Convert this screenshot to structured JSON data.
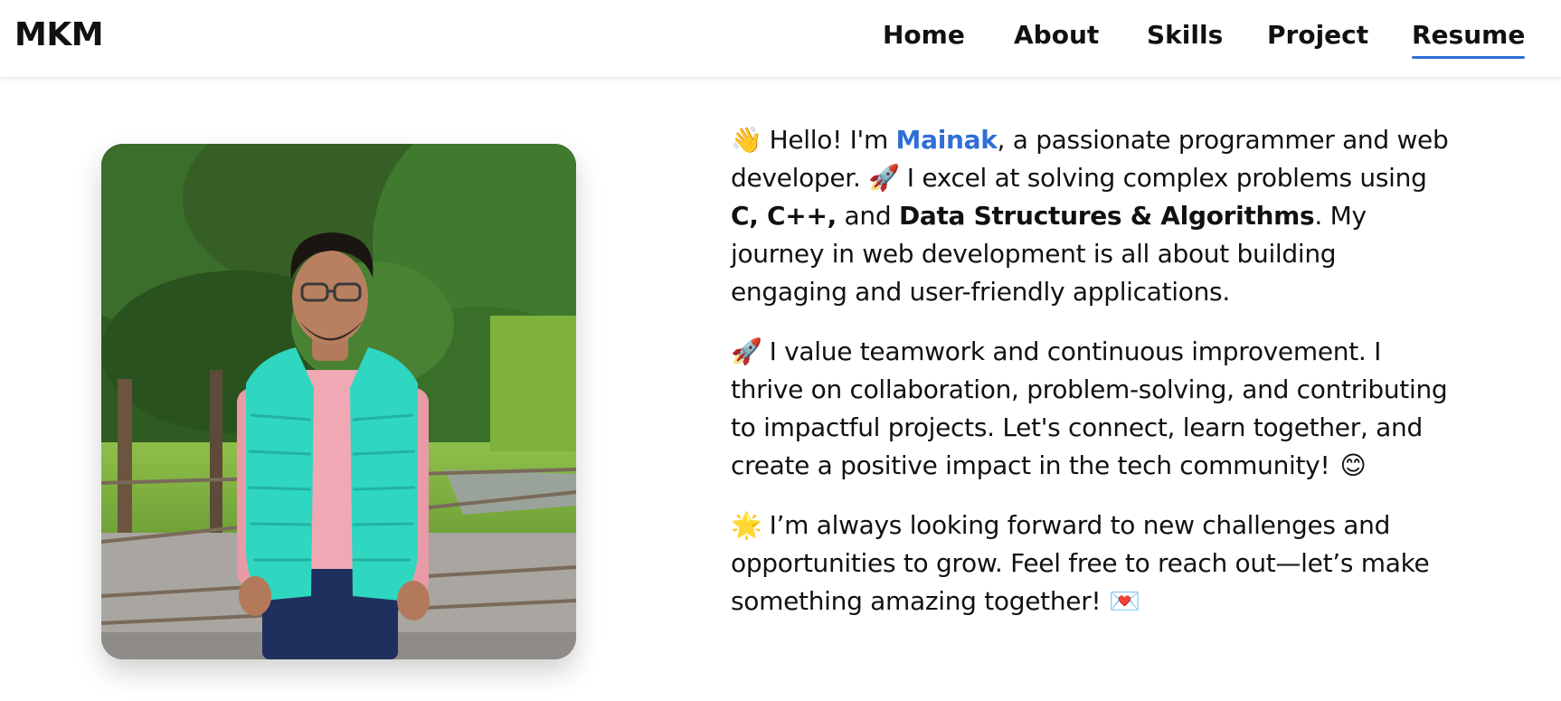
{
  "brand": {
    "logo": "MKM"
  },
  "nav": {
    "items": [
      {
        "label": "Home",
        "active": false
      },
      {
        "label": "About",
        "active": false
      },
      {
        "label": "Skills",
        "active": false
      },
      {
        "label": "Project",
        "active": false
      },
      {
        "label": "Resume",
        "active": true
      }
    ]
  },
  "colors": {
    "accent": "#2f6fd6",
    "text": "#111111",
    "background": "#ffffff"
  },
  "profile_image": {
    "icon": "profile-photo"
  },
  "about": {
    "p1": {
      "emoji_wave": "👋",
      "greeting": " Hello! I'm ",
      "name": "Mainak",
      "after_name": ", a passionate programmer and web developer. ",
      "emoji_rocket": "🚀",
      "excel": "  I excel at solving complex problems using ",
      "langs": "C, C++,",
      "and": " and ",
      "dsa": "Data Structures & Algorithms",
      "rest": ". My journey in web development is all about building engaging and user-friendly applications."
    },
    "p2": {
      "emoji_rocket": "🚀",
      "text": " I value teamwork and continuous improvement. I thrive on collaboration, problem-solving, and contributing to impactful projects. Let's connect, learn together, and create a positive impact in the tech community! ",
      "emoji_smile": "😊"
    },
    "p3": {
      "emoji_star": "🌟",
      "text": " I’m always looking forward to new challenges and opportunities to grow. Feel free to reach out—let’s make something amazing together! ",
      "emoji_letter": "💌"
    }
  }
}
